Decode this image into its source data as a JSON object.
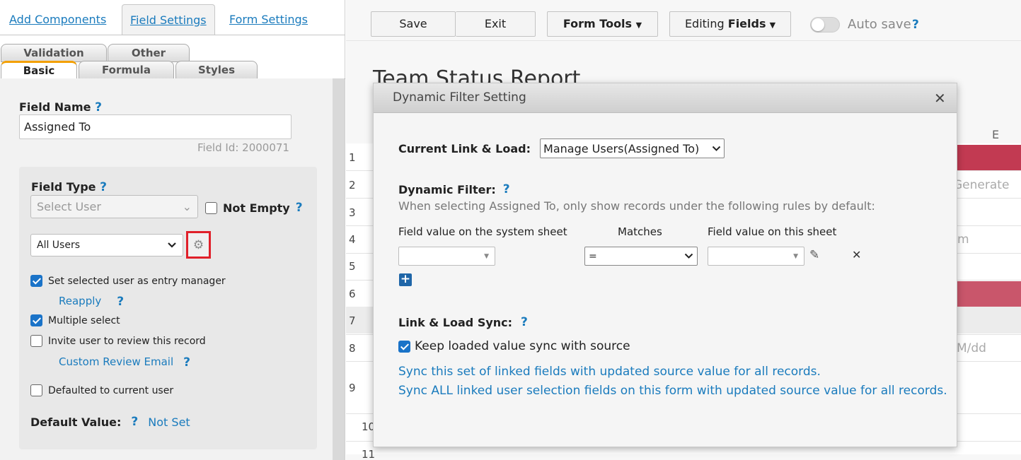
{
  "top_tabs": [
    "Add Components",
    "Field Settings",
    "Form Settings"
  ],
  "sub_tabs_row1": [
    "Validation",
    "Other"
  ],
  "sub_tabs_row2": [
    "Basic",
    "Formula",
    "Styles"
  ],
  "field_name": {
    "label": "Field Name",
    "value": "Assigned To",
    "field_id": "Field Id: 2000071"
  },
  "field_type": {
    "label": "Field Type",
    "select_value": "Select User",
    "not_empty_label": "Not Empty",
    "users_select": "All Users",
    "options": [
      {
        "label": "Set selected user as entry manager",
        "checked": true
      },
      {
        "label": "Multiple select",
        "checked": true
      },
      {
        "label": "Invite user to review this record",
        "checked": false
      },
      {
        "label": "Defaulted to current user",
        "checked": false
      }
    ],
    "reapply_link": "Reapply",
    "custom_review_link": "Custom Review Email",
    "default_value_label": "Default Value:",
    "default_value": "Not Set"
  },
  "help_mark": "?",
  "toolbar": {
    "save": "Save",
    "exit": "Exit",
    "form_tools": "Form Tools",
    "editing_prefix": "Editing",
    "editing_bold": "Fields",
    "auto_save": "Auto save"
  },
  "background": {
    "title": "Team Status Report",
    "column_e": "E",
    "row_numbers": [
      "1",
      "2",
      "3",
      "4",
      "5",
      "6",
      "7",
      "8",
      "9",
      "10",
      "11"
    ],
    "cell_generate": "Generate",
    "cell_m": "m",
    "cell_date": "M/dd"
  },
  "modal": {
    "title": "Dynamic Filter Setting",
    "current_link_label": "Current Link & Load:",
    "current_link_value": "Manage Users(Assigned To)",
    "dynamic_filter_label": "Dynamic Filter:",
    "dynamic_filter_desc": "When selecting Assigned To, only show records under the following rules by default:",
    "col_system": "Field value on the system sheet",
    "col_matches": "Matches",
    "col_this": "Field value on this sheet",
    "match_value": "=",
    "sync_label": "Link & Load Sync:",
    "keep_sync_label": "Keep loaded value sync with source",
    "keep_sync_checked": true,
    "sync_link1": "Sync this set of linked fields with updated source value for all records.",
    "sync_link2": "Sync ALL linked user selection fields on this form with updated source value for all records."
  },
  "colors": {
    "link": "#1a7bbd",
    "accent_tab": "#f3a000",
    "highlight_box": "#e0202a",
    "red_row": "#c23a52"
  }
}
